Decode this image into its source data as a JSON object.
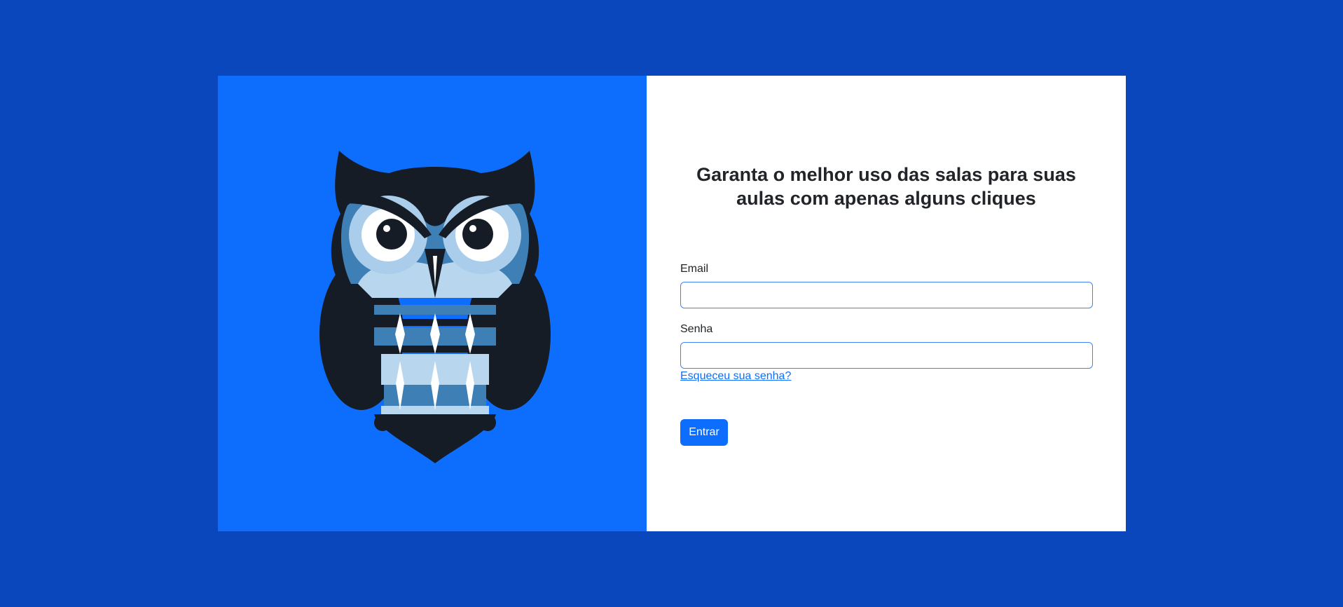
{
  "hero": {
    "image": "owl-illustration",
    "brand_color": "#0d6efd",
    "page_background": "#0a47bd"
  },
  "login": {
    "headline": "Garanta o melhor uso das salas para suas aulas com apenas alguns cliques",
    "email_label": "Email",
    "email_value": "",
    "password_label": "Senha",
    "password_value": "",
    "forgot_link": "Esqueceu sua senha?",
    "submit_label": "Entrar"
  }
}
